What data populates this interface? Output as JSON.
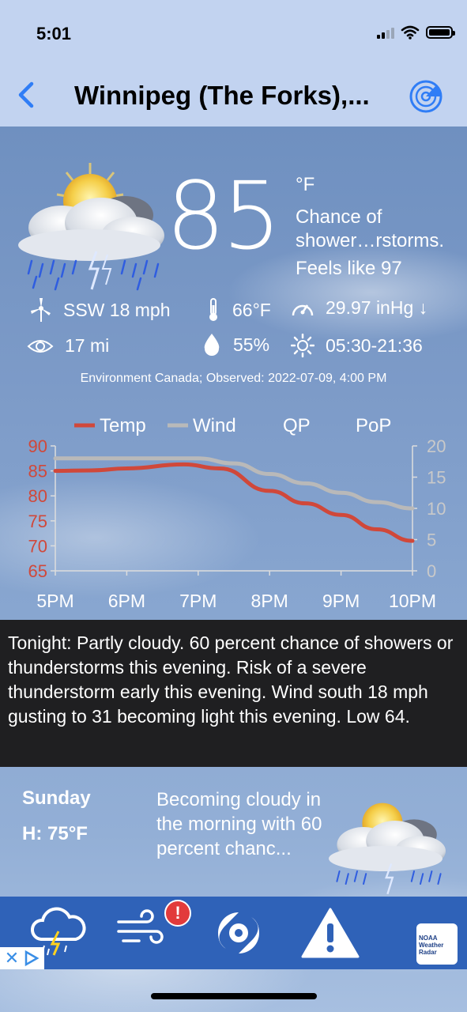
{
  "status_bar": {
    "time": "5:01"
  },
  "nav": {
    "title": "Winnipeg (The Forks),...",
    "back_icon": "chevron-left-icon",
    "radar_icon": "radar-icon"
  },
  "current": {
    "temperature": "85",
    "unit": "°F",
    "condition": "Chance of shower…rstorms.",
    "feels_like": "Feels like 97",
    "wind": "SSW 18 mph",
    "dewpoint": "66°F",
    "pressure": "29.97 inHg ↓",
    "visibility": "17 mi",
    "humidity": "55%",
    "sun": "05:30-21:36",
    "source": "Environment Canada; Observed: 2022-07-09, 4:00 PM"
  },
  "colors": {
    "temp_series": "#d0483a",
    "wind_series": "#b9b9b9",
    "nav_bg": "#c2d3f0",
    "ad_bg": "#2f62b8"
  },
  "chart_data": {
    "type": "line",
    "legend": [
      "Temp",
      "Wind",
      "QP",
      "PoP"
    ],
    "x": [
      "5PM",
      "6PM",
      "7PM",
      "8PM",
      "9PM",
      "10PM"
    ],
    "y_left_ticks": [
      "90",
      "85",
      "80",
      "75",
      "70",
      "65"
    ],
    "y_right_ticks": [
      "20",
      "15",
      "10",
      "5",
      "0"
    ],
    "y_left_range": [
      65,
      90
    ],
    "y_right_range": [
      0,
      20
    ],
    "series": [
      {
        "name": "Temp",
        "axis": "left",
        "x": [
          5,
          5.5,
          6,
          6.8,
          7.3,
          8,
          8.5,
          9,
          9.5,
          10
        ],
        "values": [
          85,
          85.1,
          85.5,
          86.3,
          85.5,
          81,
          78.5,
          76.2,
          73.3,
          71
        ]
      },
      {
        "name": "Wind",
        "axis": "right",
        "x": [
          5,
          6,
          7,
          7.5,
          8,
          8.5,
          9,
          9.5,
          10
        ],
        "values": [
          18,
          18,
          18,
          17.2,
          15.5,
          14,
          12.5,
          11,
          10
        ]
      }
    ]
  },
  "forecast": {
    "tonight": "Tonight:  Partly cloudy. 60 percent chance of showers or thunderstorms this evening. Risk of a severe thunderstorm early this evening. Wind south 18 mph gusting to 31 becoming light this evening. Low 64."
  },
  "next_day": {
    "name": "Sunday",
    "high": "H: 75°F",
    "summary": "Becoming cloudy in the morning with 60 percent chanc..."
  },
  "ad": {
    "noaa_label": "NOAA Weather Radar"
  }
}
